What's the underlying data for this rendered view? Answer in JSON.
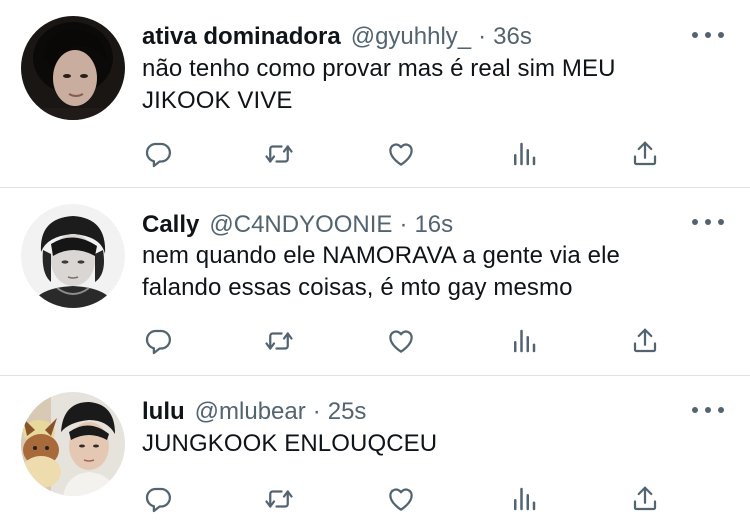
{
  "tweets": [
    {
      "name": "ativa dominadora",
      "handle": "@gyuhhly_",
      "separator": "·",
      "time": "36s",
      "text_lines": [
        "não tenho como provar mas é real sim MEU",
        "JIKOOK VIVE"
      ]
    },
    {
      "name": "Cally",
      "handle": "@C4NDYOONIE",
      "separator": "·",
      "time": "16s",
      "text_lines": [
        "nem quando ele NAMORAVA a gente via ele",
        "falando essas coisas, é mto gay mesmo"
      ]
    },
    {
      "name": "lulu",
      "handle": "@mlubear",
      "separator": "·",
      "time": "25s",
      "text_lines": [
        "JUNGKOOK ENLOUQCEU"
      ]
    }
  ],
  "icons": {
    "more": "more-dots-icon",
    "reply": "reply-icon",
    "retweet": "retweet-icon",
    "like": "heart-icon",
    "views": "views-chart-icon",
    "share": "share-icon"
  },
  "colors": {
    "text": "#0f1419",
    "secondary": "#536471",
    "divider": "#dde3e8",
    "background": "#ffffff"
  }
}
